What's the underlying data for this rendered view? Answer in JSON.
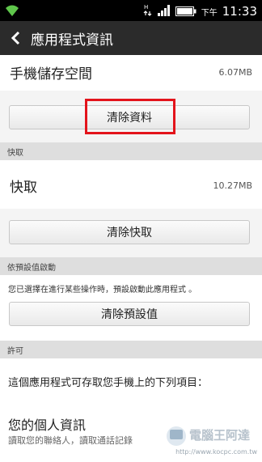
{
  "status_bar": {
    "ampm": "下午",
    "time": "11:33"
  },
  "app_bar": {
    "title": "應用程式資訊"
  },
  "storage": {
    "label": "手機儲存空間",
    "size": "6.07MB",
    "clear_button": "清除資料"
  },
  "cache_section": {
    "header": "快取",
    "label": "快取",
    "size": "10.27MB",
    "clear_button": "清除快取"
  },
  "defaults_section": {
    "header": "依預設值啟動",
    "description": "您已選擇在進行某些操作時，預設啟動此應用程式 。",
    "clear_button": "清除預設值"
  },
  "permissions_section": {
    "header": "許可",
    "intro": "這個應用程式可存取您手機上的下列項目：",
    "personal_title": "您的個人資訊",
    "personal_desc": "讀取您的聯絡人，讀取通話記錄"
  },
  "watermark": {
    "brand": "電腦王阿達",
    "url": "http://www.kocpc.com.tw"
  },
  "colors": {
    "highlight": "#e3131b",
    "appbar": "#2b2b2b",
    "section_header": "#dedede"
  }
}
